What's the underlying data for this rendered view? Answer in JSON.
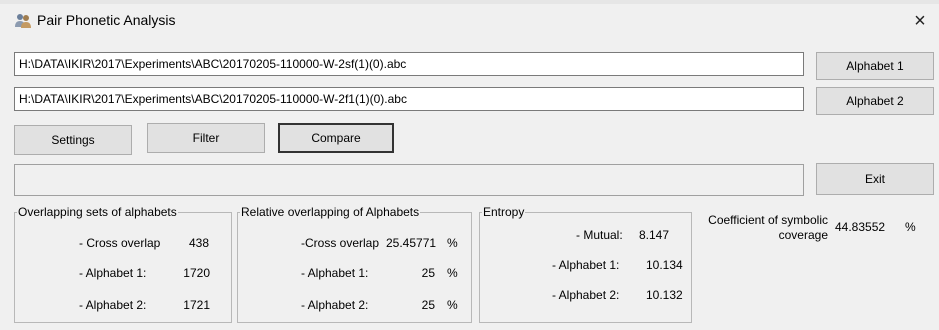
{
  "window": {
    "title": "Pair Phonetic Analysis",
    "close_glyph": "×",
    "app_icon": "users-icon"
  },
  "files": {
    "path1": "H:\\DATA\\IKIR\\2017\\Experiments\\ABC\\20170205-110000-W-2sf(1)(0).abc",
    "path2": "H:\\DATA\\IKIR\\2017\\Experiments\\ABC\\20170205-110000-W-2f1(1)(0).abc",
    "alphabet1_label": "Alphabet 1",
    "alphabet2_label": "Alphabet 2"
  },
  "toolbar": {
    "settings_label": "Settings",
    "filter_label": "Filter",
    "compare_label": "Compare",
    "exit_label": "Exit"
  },
  "status": {
    "text": ""
  },
  "overlap_sets": {
    "title": "Overlapping sets of alphabets",
    "cross_label": "- Cross overlap",
    "cross_value": "438",
    "a1_label": "- Alphabet 1:",
    "a1_value": "1720",
    "a2_label": "- Alphabet 2:",
    "a2_value": "1721"
  },
  "relative": {
    "title": "Relative overlapping of Alphabets",
    "cross_label": "-Cross overlap",
    "cross_value": "25.45771",
    "a1_label": "- Alphabet 1:",
    "a1_value": "25",
    "a2_label": "- Alphabet 2:",
    "a2_value": "25",
    "unit": "%"
  },
  "entropy": {
    "title": "Entropy",
    "mutual_label": "- Mutual:",
    "mutual_value": "8.147",
    "a1_label": "- Alphabet 1:",
    "a1_value": "10.134",
    "a2_label": "- Alphabet 2:",
    "a2_value": "10.132"
  },
  "coverage": {
    "label_line1": "Coefficient of symbolic",
    "label_line2": "coverage",
    "value": "44.83552",
    "unit": "%"
  }
}
